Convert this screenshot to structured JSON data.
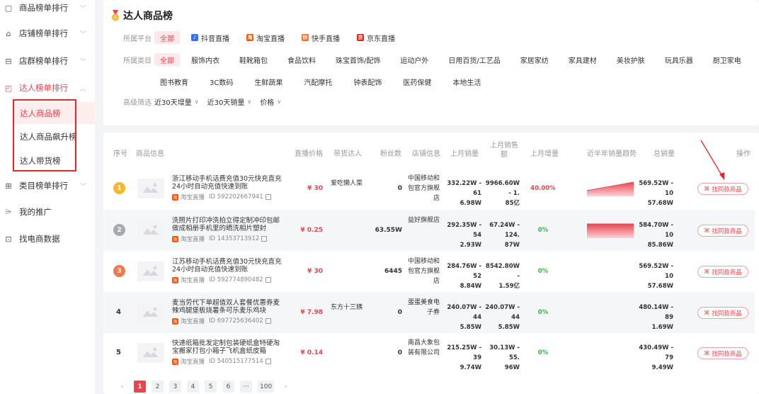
{
  "sidebar": {
    "items": [
      {
        "label": "商品榜单排行",
        "icon": "product-ranking-icon"
      },
      {
        "label": "店铺榜单排行",
        "icon": "shop-ranking-icon"
      },
      {
        "label": "店群榜单排行",
        "icon": "shop-group-icon"
      },
      {
        "label": "达人榜单排行",
        "icon": "influencer-ranking-icon"
      },
      {
        "label": "类目榜单排行",
        "icon": "category-ranking-icon"
      },
      {
        "label": "我的推广",
        "icon": "promotion-icon"
      },
      {
        "label": "找电商数据",
        "icon": "data-search-icon"
      }
    ],
    "sub_items": [
      "达人商品榜",
      "达人商品飙升榜",
      "达人带货榜"
    ]
  },
  "filter": {
    "title": "达人商品榜",
    "platform_label": "所属平台",
    "platforms": [
      "全部",
      "抖音直播",
      "淘宝直播",
      "快手直播",
      "京东直播"
    ],
    "category_label": "所属类目",
    "categories_row1": [
      "全部",
      "服饰内衣",
      "鞋靴箱包",
      "食品饮料",
      "珠宝首饰/配饰",
      "运动户外",
      "日用百货/工艺品",
      "家居家纺",
      "家具建材",
      "美妆护肤",
      "玩具乐器",
      "厨卫家电"
    ],
    "categories_row2": [
      "图书教育",
      "3C数码",
      "生鲜蔬果",
      "汽配摩托",
      "钟表配饰",
      "医药保健",
      "本地生活"
    ],
    "advanced_label": "高级筛选",
    "advanced": [
      "近30天增量",
      "近30天销量",
      "价格"
    ]
  },
  "table": {
    "headers": {
      "rank": "序号",
      "product": "商品信息",
      "price": "直播价格",
      "influencer": "带货达人",
      "fans": "粉丝数",
      "shop": "店铺信息",
      "last_sales": "上月销量",
      "last_amount": "上月销售额",
      "last_growth": "上月增量",
      "trend": "近半年销量趋势",
      "total": "总销量",
      "action": "操作"
    },
    "rows": [
      {
        "rank": "1",
        "name": "浙江移动手机话费充值30元快充直充24小时自动充值快速到账",
        "platform": "淘宝直播",
        "id": "ID 592202667941",
        "price": "¥ 30",
        "influencer": "爱吃懒人菜",
        "fans": "0",
        "shop": "中国移动和包官方旗舰店",
        "last_sales_a": "332.22W - 61",
        "last_sales_b": "6.98W",
        "last_amount_a": "9966.60W - 1.",
        "last_amount_b": "85亿",
        "growth": "40.00%",
        "total_a": "569.52W - 10",
        "total_b": "57.68W",
        "action": "找同款商品",
        "trend": "up"
      },
      {
        "rank": "2",
        "name": "洗照片打印冲洗拍立得定制冲印包邮做成相册手机里的晒洗相片塑封",
        "platform": "淘宝直播",
        "id": "ID 14353713912",
        "price": "¥ 0.25",
        "influencer": "",
        "fans": "63.55W",
        "shop": "益好旗舰店",
        "last_sales_a": "292.35W - 54",
        "last_sales_b": "2.93W",
        "last_amount_a": "67.24W - 124.",
        "last_amount_b": "87W",
        "growth": "0%",
        "total_a": "584.70W - 10",
        "total_b": "85.86W",
        "action": "找同款商品",
        "trend": "flat"
      },
      {
        "rank": "3",
        "name": "江苏移动手机话费充值30元快充直充24小时自动充值快速到账",
        "platform": "淘宝直播",
        "id": "ID 592774890482",
        "price": "¥ 30",
        "influencer": "",
        "fans": "6445",
        "shop": "中国移动和包官方旗舰店",
        "last_sales_a": "284.76W - 52",
        "last_sales_b": "8.84W",
        "last_amount_a": "8542.80W -",
        "last_amount_b": "1.59亿",
        "growth": "0%",
        "total_a": "569.52W - 10",
        "total_b": "57.68W",
        "action": "找同款商品",
        "trend": "none"
      },
      {
        "rank": "4",
        "name": "麦当劳代下单超值双人套餐优惠券麦辣鸡腿堡板烧薯条可乐麦乐鸡块",
        "platform": "淘宝直播",
        "id": "ID 697725636402",
        "price": "¥ 7.98",
        "influencer": "东方十三姨",
        "fans": "0",
        "shop": "蛋蛋美食电子券",
        "last_sales_a": "240.07W - 44",
        "last_sales_b": "5.85W",
        "last_amount_a": "240.07W - 44",
        "last_amount_b": "5.85W",
        "growth": "0%",
        "total_a": "480.14W - 89",
        "total_b": "1.69W",
        "action": "找同款商品",
        "trend": "none"
      },
      {
        "rank": "5",
        "name": "快递纸箱批发定制包装硬纸盒特硬淘宝搬家打包小箱子飞机盒纸皮箱",
        "platform": "淘宝直播",
        "id": "ID 540515177514",
        "price": "¥ 0.14",
        "influencer": "",
        "fans": "0",
        "shop": "南昌大象包装有限公司",
        "last_sales_a": "215.25W - 39",
        "last_sales_b": "9.74W",
        "last_amount_a": "30.13W - 55.",
        "last_amount_b": "96W",
        "growth": "0%",
        "total_a": "430.49W - 79",
        "total_b": "9.49W",
        "action": "找同款商品",
        "trend": "none"
      }
    ]
  },
  "pagination": {
    "pages": [
      "1",
      "2",
      "3",
      "4",
      "5",
      "6",
      "···",
      "100"
    ],
    "current": "1"
  },
  "colors": {
    "accent": "#e8464f",
    "gold": "#f5b731",
    "silver": "#a8aab0",
    "bronze": "#f07a4e",
    "taobao": "#ff5000"
  }
}
